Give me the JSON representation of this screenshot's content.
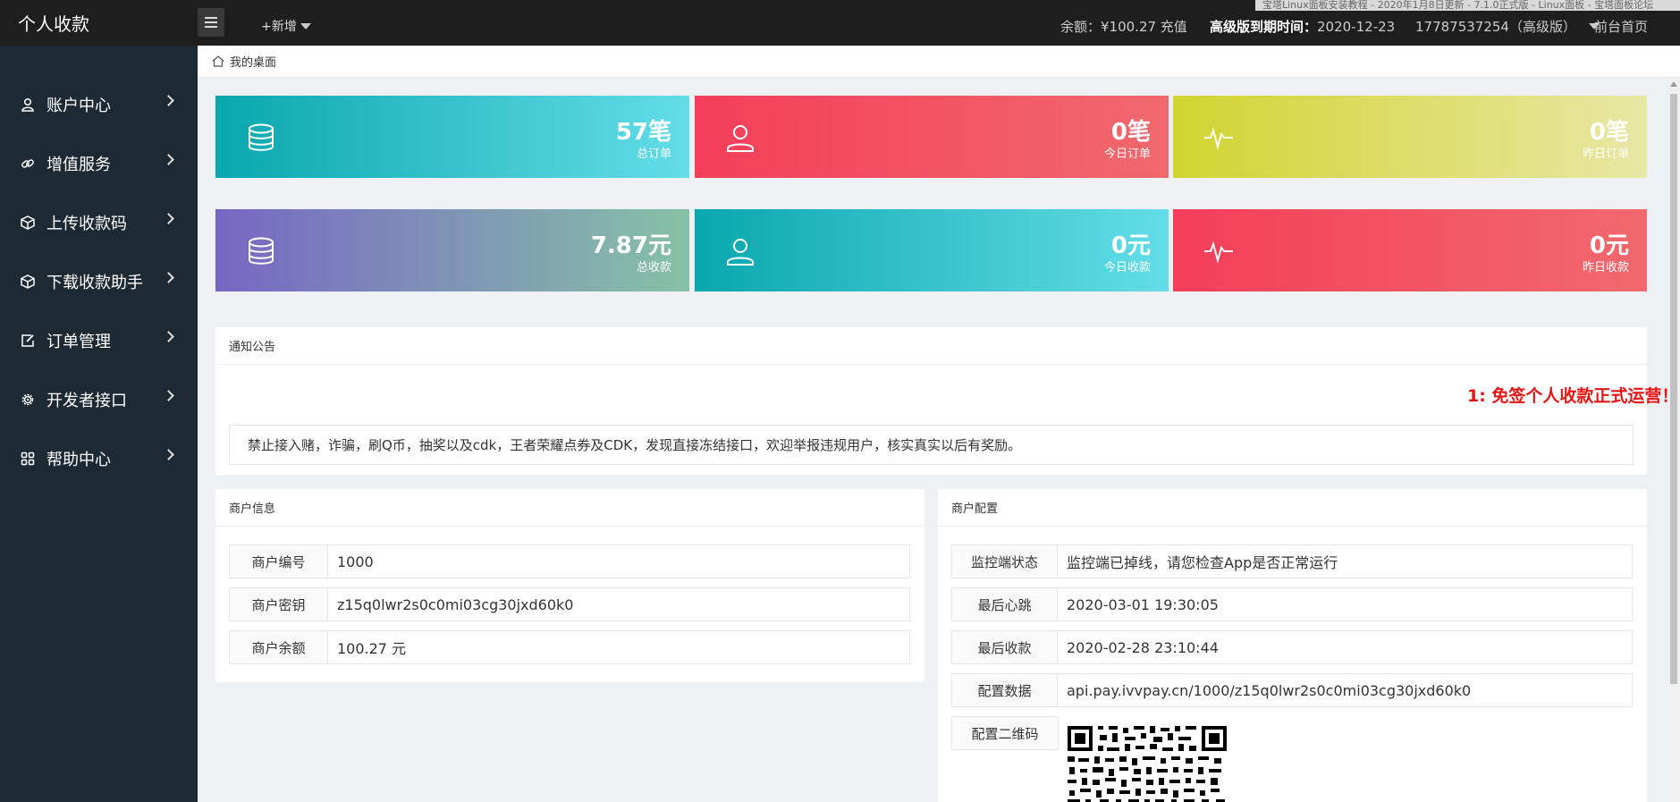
{
  "app": {
    "brand": "个人收款"
  },
  "topbar": {
    "add_new": "+新增",
    "balance": "余额：¥100.27 充值",
    "expire_label": "高级版到期时间：",
    "expire_date": "2020-12-23",
    "account": "17787537254（高级版）",
    "home": "前台首页",
    "ticker": "宝塔Linux面板安装教程 - 2020年1月8日更新 - 7.1.0正式版 - Linux面板 - 宝塔面板论坛"
  },
  "sidebar": {
    "items": [
      {
        "label": "账户中心",
        "icon": "user-icon"
      },
      {
        "label": "增值服务",
        "icon": "link-icon"
      },
      {
        "label": "上传收款码",
        "icon": "cube-icon"
      },
      {
        "label": "下载收款助手",
        "icon": "cube-icon"
      },
      {
        "label": "订单管理",
        "icon": "edit-icon"
      },
      {
        "label": "开发者接口",
        "icon": "gear-icon"
      },
      {
        "label": "帮助中心",
        "icon": "grid-icon"
      }
    ]
  },
  "breadcrumb": {
    "label": "我的桌面"
  },
  "stats": [
    {
      "value": "57笔",
      "label": "总订单",
      "icon": "database-icon",
      "color": "#0aa7ae"
    },
    {
      "value": "0笔",
      "label": "今日订单",
      "icon": "user-icon",
      "color": "#f43e5a"
    },
    {
      "value": "0笔",
      "label": "昨日订单",
      "icon": "pulse-icon",
      "color": "#d2d431"
    },
    {
      "value": "7.87元",
      "label": "总收款",
      "icon": "database-icon",
      "color": "#7766c4"
    },
    {
      "value": "0元",
      "label": "今日收款",
      "icon": "user-icon",
      "color": "#0aa7ae"
    },
    {
      "value": "0元",
      "label": "昨日收款",
      "icon": "pulse-icon",
      "color": "#f43e5a"
    }
  ],
  "notice": {
    "title": "通知公告",
    "headline": "1: 免签个人收款正式运营！",
    "text": "禁止接入赌，诈骗，刷Q币，抽奖以及cdk，王者荣耀点券及CDK，发现直接冻结接口，欢迎举报违规用户，核实真实以后有奖励。"
  },
  "merchant_info": {
    "title": "商户信息",
    "rows": [
      {
        "key": "商户编号",
        "value": "1000"
      },
      {
        "key": "商户密钥",
        "value": "z15q0lwr2s0c0mi03cg30jxd60k0"
      },
      {
        "key": "商户余额",
        "value": "100.27 元"
      }
    ]
  },
  "merchant_config": {
    "title": "商户配置",
    "rows": [
      {
        "key": "监控端状态",
        "value": "监控端已掉线，请您检查App是否正常运行"
      },
      {
        "key": "最后心跳",
        "value": "2020-03-01 19:30:05"
      },
      {
        "key": "最后收款",
        "value": "2020-02-28 23:10:44"
      },
      {
        "key": "配置数据",
        "value": "api.pay.ivvpay.cn/1000/z15q0lwr2s0c0mi03cg30jxd60k0"
      }
    ],
    "qr_label": "配置二维码"
  }
}
